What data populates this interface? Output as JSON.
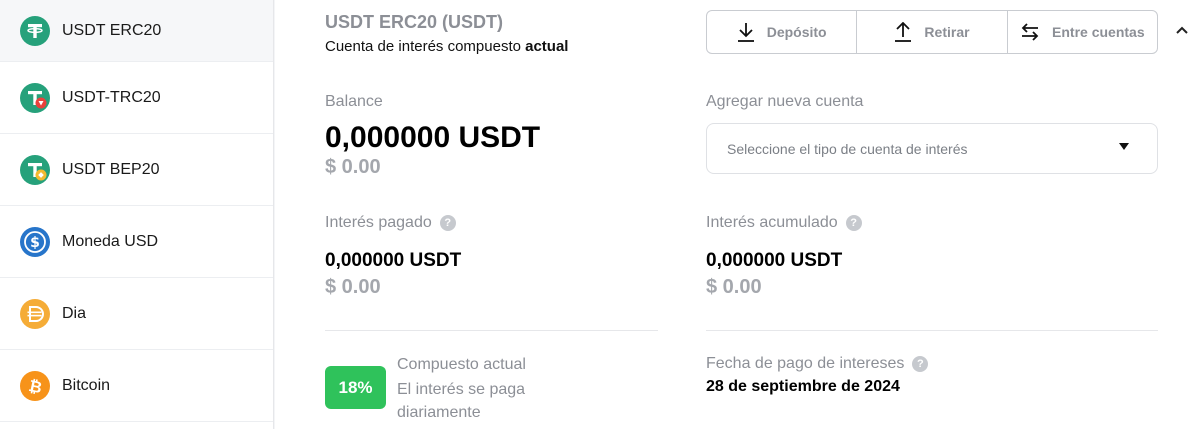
{
  "sidebar": {
    "items": [
      {
        "label": "USDT ERC20",
        "icon": "tether-icon"
      },
      {
        "label": "USDT-TRC20",
        "icon": "tether-trc20-icon"
      },
      {
        "label": "USDT BEP20",
        "icon": "tether-bep20-icon"
      },
      {
        "label": "Moneda USD",
        "icon": "usd-coin-icon"
      },
      {
        "label": "Dia",
        "icon": "dai-icon"
      },
      {
        "label": "Bitcoin",
        "icon": "bitcoin-icon"
      }
    ]
  },
  "header": {
    "title": "USDT ERC20 (USDT)",
    "subtitle_prefix": "Cuenta de interés compuesto",
    "subtitle_bold": "actual"
  },
  "actions": {
    "deposit": "Depósito",
    "withdraw": "Retirar",
    "transfer": "Entre cuentas"
  },
  "balance": {
    "label": "Balance",
    "amount": "0,000000 USDT",
    "usd": "$ 0.00"
  },
  "new_account": {
    "label": "Agregar nueva cuenta",
    "placeholder": "Seleccione el tipo de cuenta de interés"
  },
  "interest_paid": {
    "label": "Interés pagado",
    "amount": "0,000000 USDT",
    "usd": "$ 0.00"
  },
  "interest_accrued": {
    "label": "Interés acumulado",
    "amount": "0,000000 USDT",
    "usd": "$ 0.00"
  },
  "rate": {
    "badge": "18%",
    "title": "Compuesto actual",
    "description": "El interés se paga diariamente"
  },
  "payment": {
    "label": "Fecha de pago de intereses",
    "date": "28 de septiembre de 2024"
  },
  "help_glyph": "?",
  "colors": {
    "tether": "#26a17b",
    "usdc": "#2775ca",
    "dai": "#f5ac37",
    "bitcoin": "#f7931a",
    "badge": "#2fc25b"
  }
}
